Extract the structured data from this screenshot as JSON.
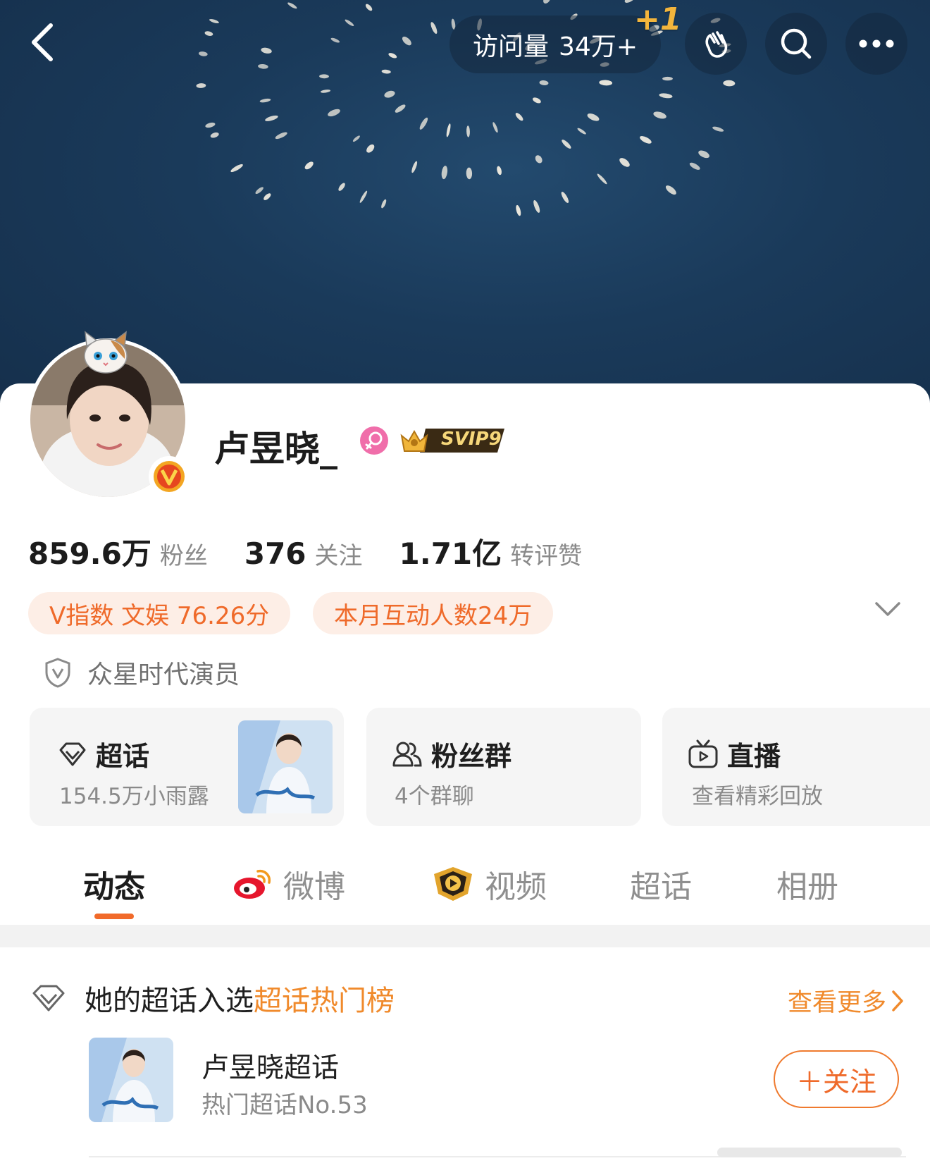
{
  "header": {
    "visits_label": "访问量",
    "visits_value": "34万+",
    "visits_plus": "+1"
  },
  "profile": {
    "name": "卢昱晓_",
    "vip_badge": "SVIP9",
    "stats": [
      {
        "value": "859.6万",
        "label": "粉丝"
      },
      {
        "value": "376",
        "label": "关注"
      },
      {
        "value": "1.71亿",
        "label": "转评赞"
      }
    ],
    "tags": [
      "V指数 文娱 76.26分",
      "本月互动人数24万"
    ],
    "organization": "众星时代演员",
    "accent_color": "#f16a2a"
  },
  "features": [
    {
      "title": "超话",
      "subtitle": "154.5万小雨露",
      "icon": "diamond-icon"
    },
    {
      "title": "粉丝群",
      "subtitle": "4个群聊",
      "icon": "people-icon"
    },
    {
      "title": "直播",
      "subtitle": "查看精彩回放",
      "icon": "tv-icon"
    }
  ],
  "tabs": [
    "动态",
    "微博",
    "视频",
    "超话",
    "相册"
  ],
  "active_tab": "动态",
  "super_topic": {
    "title_prefix": "她的超话入选",
    "title_highlight": "超话热门榜",
    "see_more": "查看更多",
    "topic_name": "卢昱晓超话",
    "topic_rank": "热门超话No.53",
    "follow_label": "＋关注"
  }
}
